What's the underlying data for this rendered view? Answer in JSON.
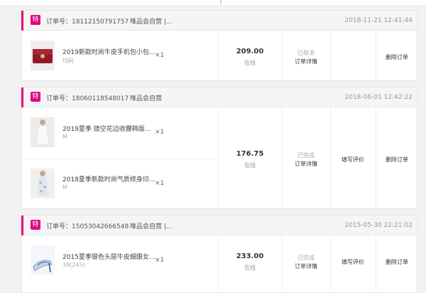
{
  "badge": "特",
  "orders": [
    {
      "order_no": "订单号：18112150791757",
      "store": "唯品会自营 |...",
      "time": "2018-11-21 12:41:44",
      "items": [
        {
          "name": "2019新款时尚牛皮手机包小包...",
          "attr": "均码",
          "qty": "×1",
          "thumb": "red-bag"
        }
      ],
      "price": "209.00",
      "pay": "在线",
      "status": "已取消",
      "detail": "订单详情",
      "review": "",
      "delete": "删除订单"
    },
    {
      "order_no": "订单号：18060118548017",
      "store": "唯品会自营",
      "time": "2018-06-01 12:42:22",
      "items": [
        {
          "name": "2019夏季 镂空花边收腰韩版...",
          "attr": "M",
          "qty": "×1",
          "thumb": "white-dress"
        },
        {
          "name": "2018夏季新款时尚气质修身印...",
          "attr": "M",
          "qty": "×1",
          "thumb": "print-dress"
        }
      ],
      "price": "176.75",
      "pay": "在线",
      "status": "已完成",
      "detail": "订单详情",
      "review": "填写评价",
      "delete": "删除订单"
    },
    {
      "order_no": "订单号：15053042666548",
      "store": "唯品会自营 |...",
      "time": "2015-05-30 22:21:02",
      "items": [
        {
          "name": "2015夏季银色头层牛皮细跟女...",
          "attr": "39(245)",
          "qty": "×1",
          "thumb": "silver-sandal"
        }
      ],
      "price": "233.00",
      "pay": "在线",
      "status": "已完成",
      "detail": "订单详情",
      "review": "填写评价",
      "delete": "删除订单"
    }
  ],
  "colors": {
    "brand": "#e4007f",
    "header_bg": "#f5f5f5",
    "border": "#e6e6e6"
  }
}
